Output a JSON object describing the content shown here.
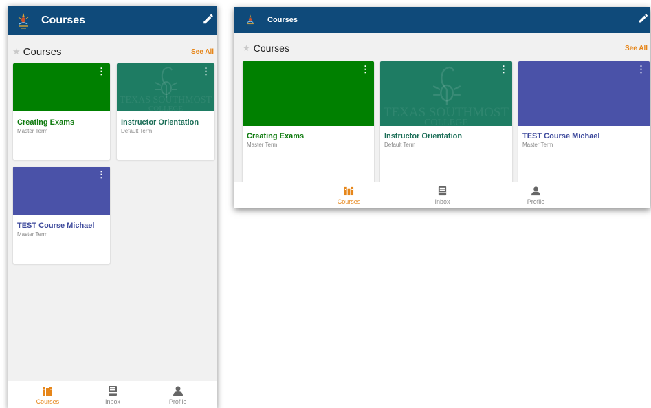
{
  "colors": {
    "appbar": "#0f4a7a",
    "accent": "#e6861a",
    "green": "#008000",
    "teal": "#1e7c63",
    "purple": "#4a52a8"
  },
  "app": {
    "title": "Courses",
    "edit_icon": "pencil-icon",
    "logo": "college-seal-logo"
  },
  "section": {
    "title": "Courses",
    "see_all": "See All",
    "star_icon": "star-icon"
  },
  "courses": [
    {
      "title": "Creating Exams",
      "term": "Master Term",
      "banner": "green",
      "title_color": "#0e7a0e"
    },
    {
      "title": "Instructor Orientation",
      "term": "Default Term",
      "banner": "teal-watermark",
      "title_color": "#1b6e57",
      "watermark_line1": "TEXAS SOUTHMOST",
      "watermark_line2": "COLLEGE"
    },
    {
      "title": "TEST Course Michael",
      "term": "Master Term",
      "banner": "purple",
      "title_color": "#3e4a9c"
    }
  ],
  "nav": [
    {
      "label": "Courses",
      "icon": "books-icon",
      "active": true
    },
    {
      "label": "Inbox",
      "icon": "inbox-icon",
      "active": false
    },
    {
      "label": "Profile",
      "icon": "person-icon",
      "active": false
    }
  ]
}
